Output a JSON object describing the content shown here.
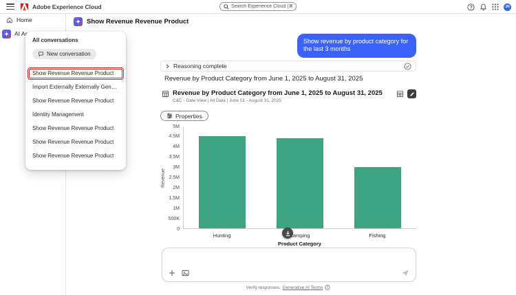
{
  "header": {
    "brand": "Adobe Experience Cloud",
    "search_placeholder": "Search Experience Cloud (⌘+/)",
    "avatar_initials": "JN"
  },
  "sidebar": {
    "items": [
      {
        "label": "Home"
      },
      {
        "label": "AI Assistant"
      }
    ]
  },
  "conversations_panel": {
    "title": "All conversations",
    "new_button": "New conversation",
    "items": [
      "Show Revenue Revenue Product",
      "Import Externally Externally Generated",
      "Show Revenue Revenue Product",
      "Identity Management",
      "Show Revenue Revenue Product",
      "Show Revenue Revenue Product",
      "Show Revenue Revenue Product"
    ]
  },
  "main": {
    "title": "Show Revenue Revenue Product",
    "user_message": "Show revenue by product category for the last 3 months",
    "reasoning_label": "Reasoning complete",
    "response_text": "Revenue by Product Category from June 1, 2025 to August 31, 2025",
    "report": {
      "title": "Revenue by Product Category from June 1, 2025 to August 31, 2025",
      "subtitle": "C&C - Date View | All Data | June 01 - August 31, 2025",
      "properties_label": "Properties"
    },
    "footer": {
      "verify_text": "Verify responses.",
      "terms_link": "Generative AI Terms"
    }
  },
  "chart_data": {
    "type": "bar",
    "title": "Revenue by Product Category from June 1, 2025 to August 31, 2025",
    "categories": [
      "Hunting",
      "Camping",
      "Fishing"
    ],
    "values": [
      4500000,
      4400000,
      3000000
    ],
    "xlabel": "Product Category",
    "ylabel": "Revenue",
    "ylim": [
      0,
      5000000
    ],
    "yticks": [
      "5M",
      "4.5M",
      "4M",
      "3.5M",
      "3M",
      "2.5M",
      "2M",
      "1.5M",
      "1M",
      "500K",
      "0"
    ],
    "bar_color": "#3da583",
    "legend": "off",
    "grid": "off"
  },
  "colors": {
    "accent_blue": "#3B63FB",
    "adobe_red": "#EB1000",
    "annotation_red": "#E8251F",
    "bar_teal": "#3da583"
  }
}
